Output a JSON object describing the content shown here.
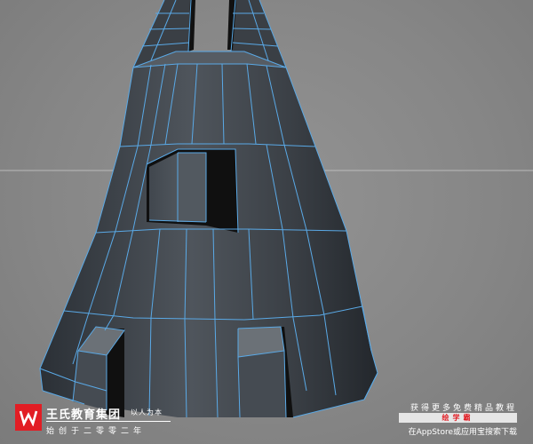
{
  "viewport": {
    "background": "#8a8a8a",
    "mesh_fill": "#3b4047",
    "wire_color": "#5aa9e6",
    "hole_color": "#111111"
  },
  "watermark": {
    "logo_letter": "W",
    "brand_name": "王氏教育集团",
    "tagline": "以人为本",
    "subline": "始创于二零零二年",
    "promo_line1": "获得更多免费精品教程",
    "promo_app": "绘学霸",
    "promo_line2": "在AppStore或应用宝搜索下载"
  }
}
